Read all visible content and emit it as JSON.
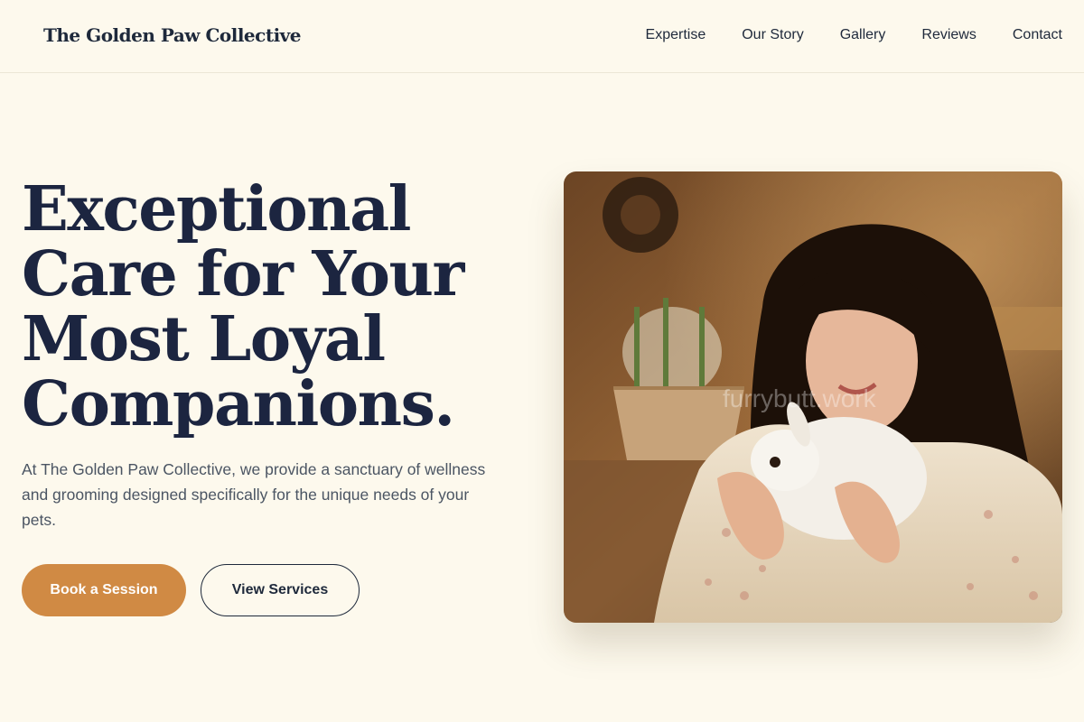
{
  "header": {
    "brand": "The Golden Paw Collective",
    "nav": [
      "Expertise",
      "Our Story",
      "Gallery",
      "Reviews",
      "Contact"
    ]
  },
  "hero": {
    "headline_lines": [
      "Exceptional",
      "Care for Your",
      "Most Loyal",
      "Companions."
    ],
    "subtext": "At The Golden Paw Collective, we provide a sanctuary of wellness and grooming designed specifically for the unique needs of your pets.",
    "primary_button": "Book a Session",
    "secondary_button": "View Services",
    "image_watermark": "furrybutt.work"
  },
  "colors": {
    "background": "#fdf9ed",
    "text_dark": "#1c2540",
    "accent": "#d08a44",
    "muted_text": "#4b5563"
  }
}
